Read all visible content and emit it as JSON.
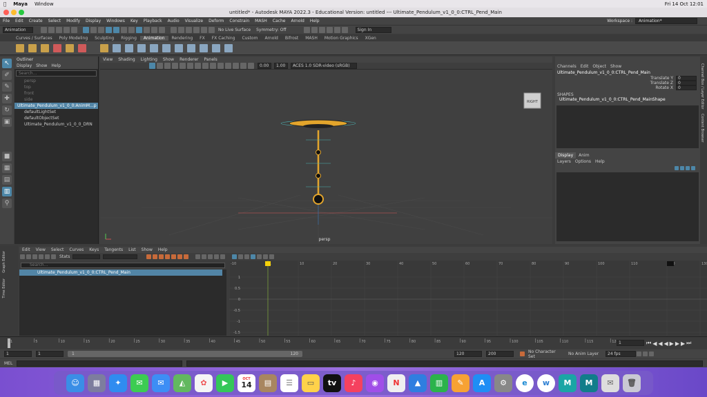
{
  "mac_menu": {
    "app": "Maya",
    "window": "Window",
    "datetime": "Fri 14 Oct  12:01"
  },
  "title": "untitled* - Autodesk MAYA 2022.3 - Educational Version: untitled  ---  Ultimate_Pendulum_v1_0_0:CTRL_Pend_Main",
  "menu": [
    "File",
    "Edit",
    "Create",
    "Select",
    "Modify",
    "Display",
    "Windows",
    "Key",
    "Playback",
    "Audio",
    "Visualize",
    "Deform",
    "Constrain",
    "MASH",
    "Cache",
    "Arnold",
    "Help"
  ],
  "workspace": {
    "label": "Workspace :",
    "value": "Animation*"
  },
  "status": {
    "mode": "Animation",
    "live": "No Live Surface",
    "symmetry": "Symmetry: Off",
    "signin": "Sign In"
  },
  "shelf_tabs": [
    "Curves / Surfaces",
    "Poly Modeling",
    "Sculpting",
    "Rigging",
    "Animation",
    "Rendering",
    "FX",
    "FX Caching",
    "Custom",
    "Arnold",
    "Bifrost",
    "MASH",
    "Motion Graphics",
    "XGen"
  ],
  "outliner": {
    "title": "Outliner",
    "menu": [
      "Display",
      "Show",
      "Help"
    ],
    "search": "Search...",
    "items": [
      {
        "label": "persp",
        "dim": true
      },
      {
        "label": "top",
        "dim": true
      },
      {
        "label": "front",
        "dim": true
      },
      {
        "label": "side",
        "dim": true
      },
      {
        "label": "Ultimate_Pendulum_v1_0_0:AnimM...p",
        "sel": true
      },
      {
        "label": "defaultLightSet"
      },
      {
        "label": "defaultObjectSet"
      },
      {
        "label": "Ultimate_Pendulum_v1_0_0_DRN"
      }
    ]
  },
  "viewport": {
    "menu": [
      "View",
      "Shading",
      "Lighting",
      "Show",
      "Renderer",
      "Panels"
    ],
    "near": "0.00",
    "far": "1.00",
    "colorspace": "ACES 1.0 SDR-video (sRGB)",
    "camera": "persp",
    "cube": "RIGHT"
  },
  "channel_box": {
    "menu": [
      "Channels",
      "Edit",
      "Object",
      "Show"
    ],
    "node": "Ultimate_Pendulum_v1_0_0:CTRL_Pend_Main",
    "attrs": [
      {
        "name": "Translate Y",
        "value": "0"
      },
      {
        "name": "Translate Z",
        "value": "0"
      },
      {
        "name": "Rotate X",
        "value": "0"
      }
    ],
    "shapes_label": "SHAPES",
    "shape": "Ultimate_Pendulum_v1_0_0:CTRL_Pend_MainShape"
  },
  "layers": {
    "tabs": [
      "Display",
      "Anim"
    ],
    "menu": [
      "Layers",
      "Options",
      "Help"
    ]
  },
  "side_tabs": [
    "Channel Box / Layer Editor",
    "Content Browser"
  ],
  "graph": {
    "menu": [
      "Edit",
      "View",
      "Select",
      "Curves",
      "Keys",
      "Tangents",
      "List",
      "Show",
      "Help"
    ],
    "stats": "Stats",
    "search": "Search...",
    "item": "Ultimate_Pendulum_v1_0_0:CTRL_Pend_Main",
    "side": [
      "Graph Editor",
      "Time Editor"
    ],
    "frames": [
      "-10",
      "1",
      "10",
      "20",
      "30",
      "40",
      "50",
      "60",
      "70",
      "80",
      "90",
      "100",
      "110",
      "120",
      "130"
    ],
    "values": [
      "1",
      "0.5",
      "0",
      "-0.5",
      "-1",
      "-1.5"
    ]
  },
  "timeslider": {
    "ticks": [
      "1",
      "5",
      "10",
      "15",
      "20",
      "25",
      "30",
      "35",
      "40",
      "45",
      "50",
      "55",
      "60",
      "65",
      "70",
      "75",
      "80",
      "85",
      "90",
      "95",
      "100",
      "105",
      "110",
      "115",
      "120"
    ],
    "current": "1"
  },
  "range": {
    "start": "1",
    "inner_start": "1",
    "slider_start": "1",
    "slider_end": "120",
    "end": "120",
    "total_end": "200",
    "character": "No Character Set",
    "anim_layer": "No Anim Layer",
    "fps": "24 fps"
  },
  "mel": "MEL",
  "dock": [
    "Finder",
    "Launchpad",
    "Safari",
    "Messages",
    "Mail",
    "Maps",
    "Photos",
    "FaceTime",
    "Calendar",
    "Notes",
    "Reminders",
    "Notes",
    "TV",
    "Music",
    "Podcasts",
    "News",
    "Keynote",
    "Numbers",
    "Pages",
    "App Store",
    "System Preferences",
    "Edge",
    "Word",
    "Maya",
    "Maya 2022",
    "Preview",
    "Trash"
  ],
  "calendar": {
    "month": "OCT",
    "day": "14"
  }
}
